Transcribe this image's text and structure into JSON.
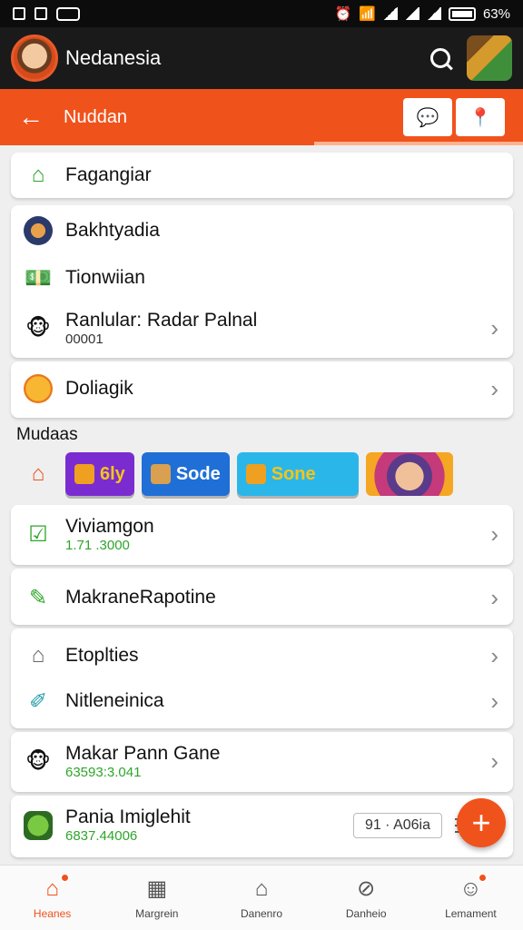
{
  "status_bar": {
    "battery": "63%"
  },
  "app_bar": {
    "title": "Nedanesia"
  },
  "nav_bar": {
    "title": "Nuddan"
  },
  "top_item": {
    "label": "Fagangiar"
  },
  "card_one": {
    "items": [
      {
        "label": "Bakhtyadia",
        "icon": "game-avatar-icon"
      },
      {
        "label": "Tionwiian",
        "icon": "money-icon"
      },
      {
        "label": "Ranlular: Radar Palnal",
        "sub": "00001",
        "icon": "monkey-icon"
      }
    ]
  },
  "coin_item": {
    "label": "Doliagik",
    "icon": "coin-icon"
  },
  "section": {
    "title": "Mudaas"
  },
  "chips": [
    {
      "label": "6ly",
      "color": "#7a2cd0"
    },
    {
      "label": "Sode",
      "color": "#1f6fd6"
    },
    {
      "label": "Sone",
      "color": "#2bb6ea"
    }
  ],
  "list_items": [
    {
      "label": "Viviamgon",
      "sub": "1.71 .3000",
      "icon": "check-icon"
    },
    {
      "label": "MakraneRapotine",
      "icon": "pen-icon"
    },
    {
      "label": "Etoplties",
      "icon": "house-icon"
    },
    {
      "label": "Nitleneinica",
      "icon": "edit-square-icon"
    },
    {
      "label": "Makar Pann Gane",
      "sub": "63593:3.041",
      "icon": "monkey-icon"
    },
    {
      "label": "Pania Imiglehit",
      "sub": "6837.44006",
      "icon": "game-icon",
      "pill": "91 · A06ia"
    }
  ],
  "fab": {
    "label": "+"
  },
  "bottom_nav": [
    {
      "label": "Heanes",
      "icon": "home-icon",
      "active": true
    },
    {
      "label": "Margrein",
      "icon": "stats-icon"
    },
    {
      "label": "Danenro",
      "icon": "building-icon"
    },
    {
      "label": "Danheio",
      "icon": "compass-icon"
    },
    {
      "label": "Lemament",
      "icon": "profile-icon"
    }
  ],
  "colors": {
    "accent": "#f0521c",
    "green": "#2ea52a"
  }
}
